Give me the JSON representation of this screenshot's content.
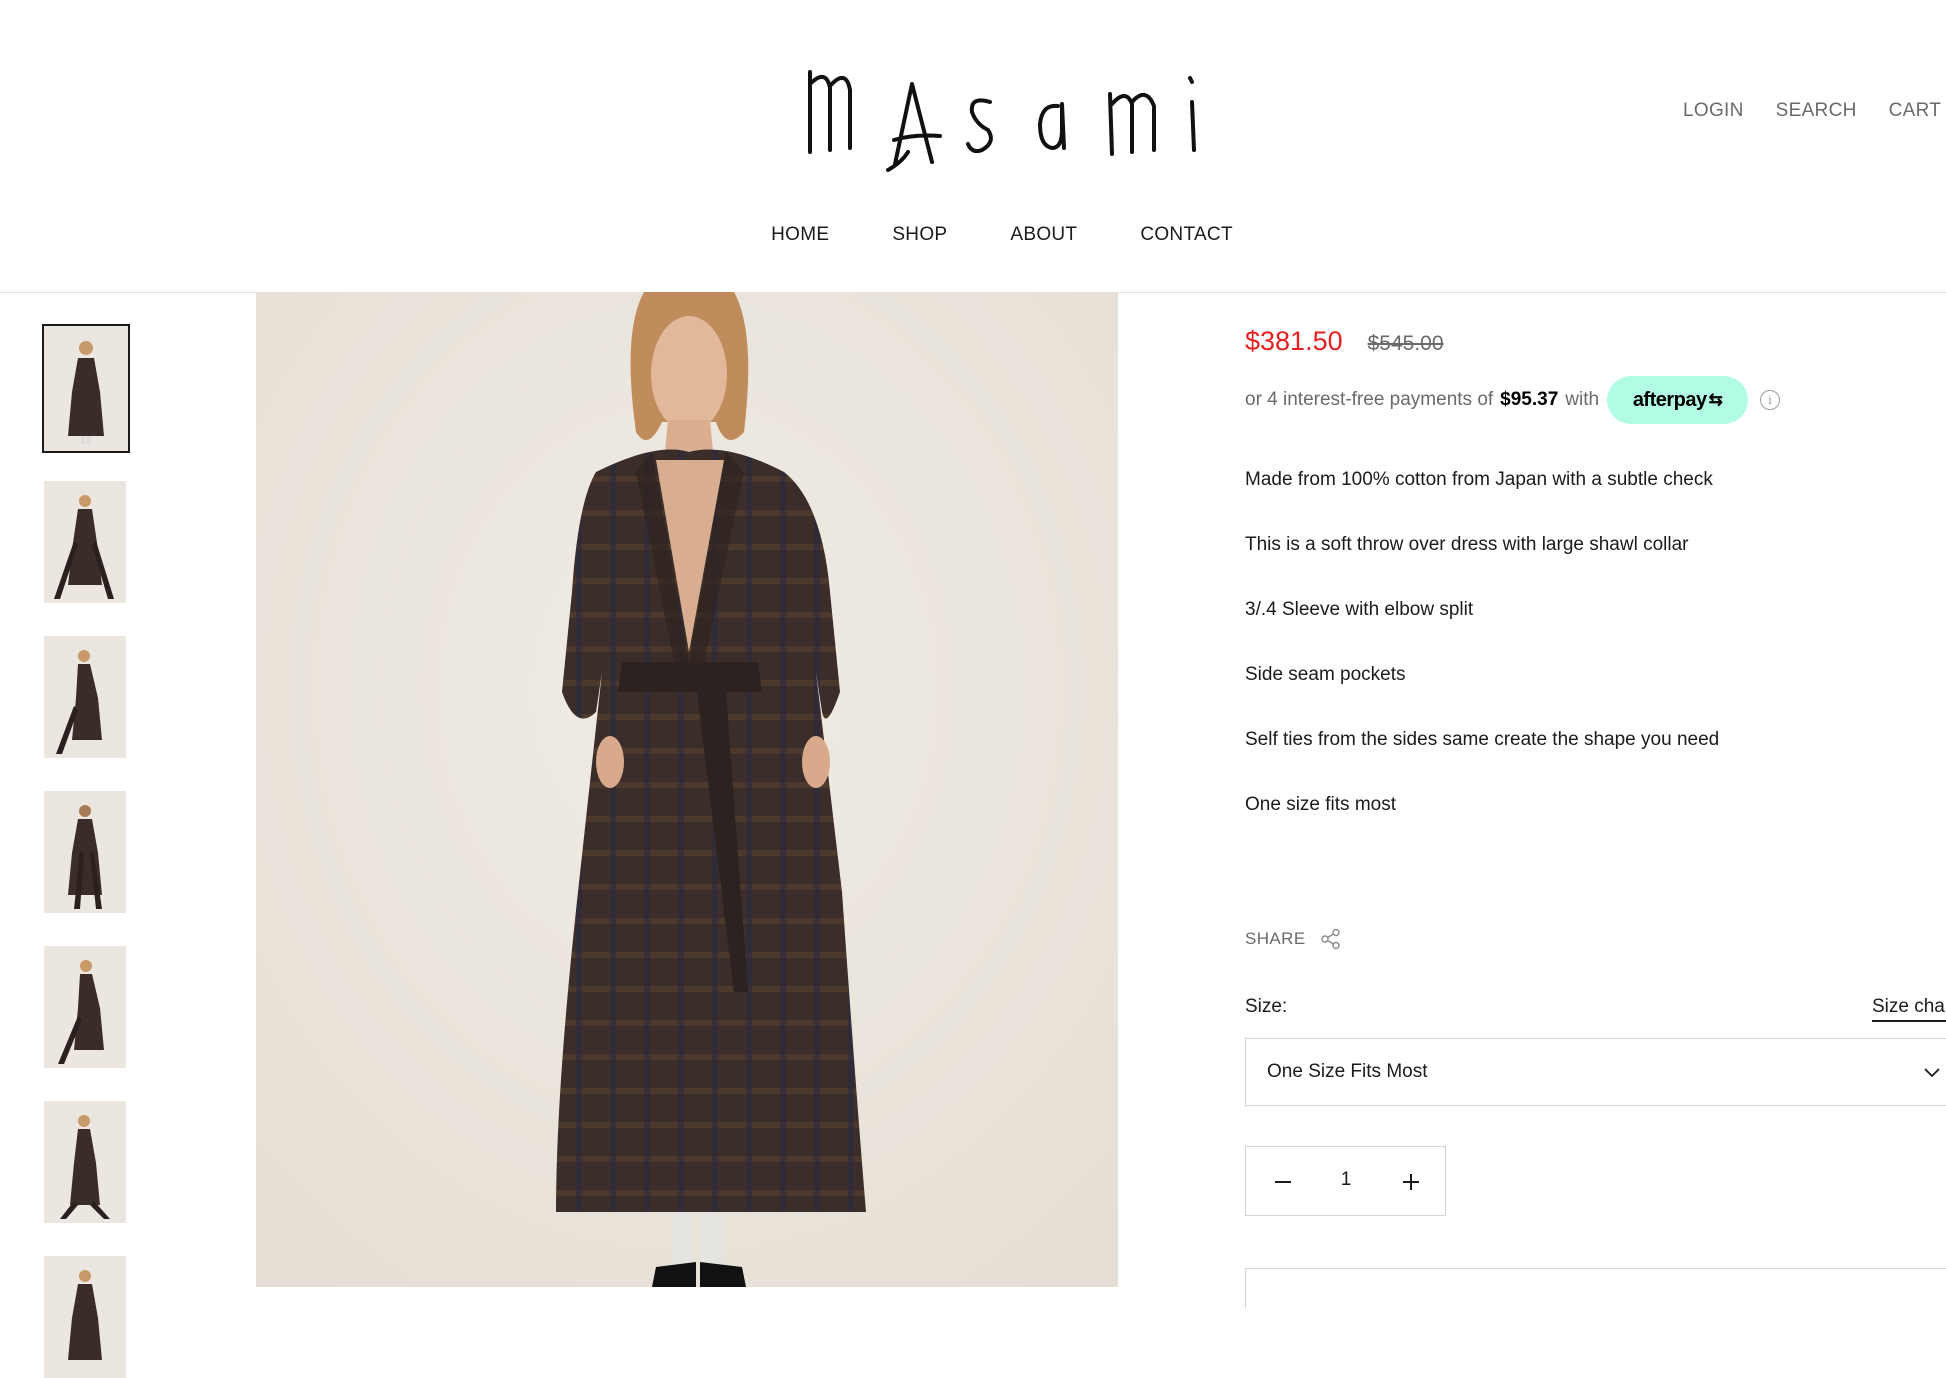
{
  "header": {
    "logo_text": "mAsami",
    "utility": {
      "login": "LOGIN",
      "search": "SEARCH",
      "cart": "CART ("
    },
    "nav": [
      "HOME",
      "SHOP",
      "ABOUT",
      "CONTACT"
    ]
  },
  "gallery": {
    "thumbnail_count": 7,
    "active_index": 0
  },
  "product": {
    "price_sale": "$381.50",
    "price_regular": "$545.00",
    "afterpay": {
      "prefix": "or 4 interest-free payments of",
      "amount": "$95.37",
      "with": "with",
      "badge": "afterpay",
      "info_icon": "info-icon"
    },
    "description": [
      "Made from 100% cotton from Japan with a subtle check",
      "This is a soft throw over dress with large shawl collar",
      "3/.4 Sleeve with elbow split",
      "Side seam pockets",
      "Self ties from the sides same create the shape you need",
      "One size fits most"
    ],
    "share_label": "SHARE",
    "size_label": "Size:",
    "size_chart_link": "Size cha",
    "size_value": "One Size Fits Most",
    "quantity": "1"
  },
  "colors": {
    "sale_price": "#e22120",
    "afterpay_badge": "#b2fce4",
    "image_background": "#ebe6df",
    "dress": "#3a2c28"
  },
  "icons": [
    "share-icon",
    "chevron-down-icon",
    "minus-icon",
    "plus-icon",
    "info-icon"
  ]
}
